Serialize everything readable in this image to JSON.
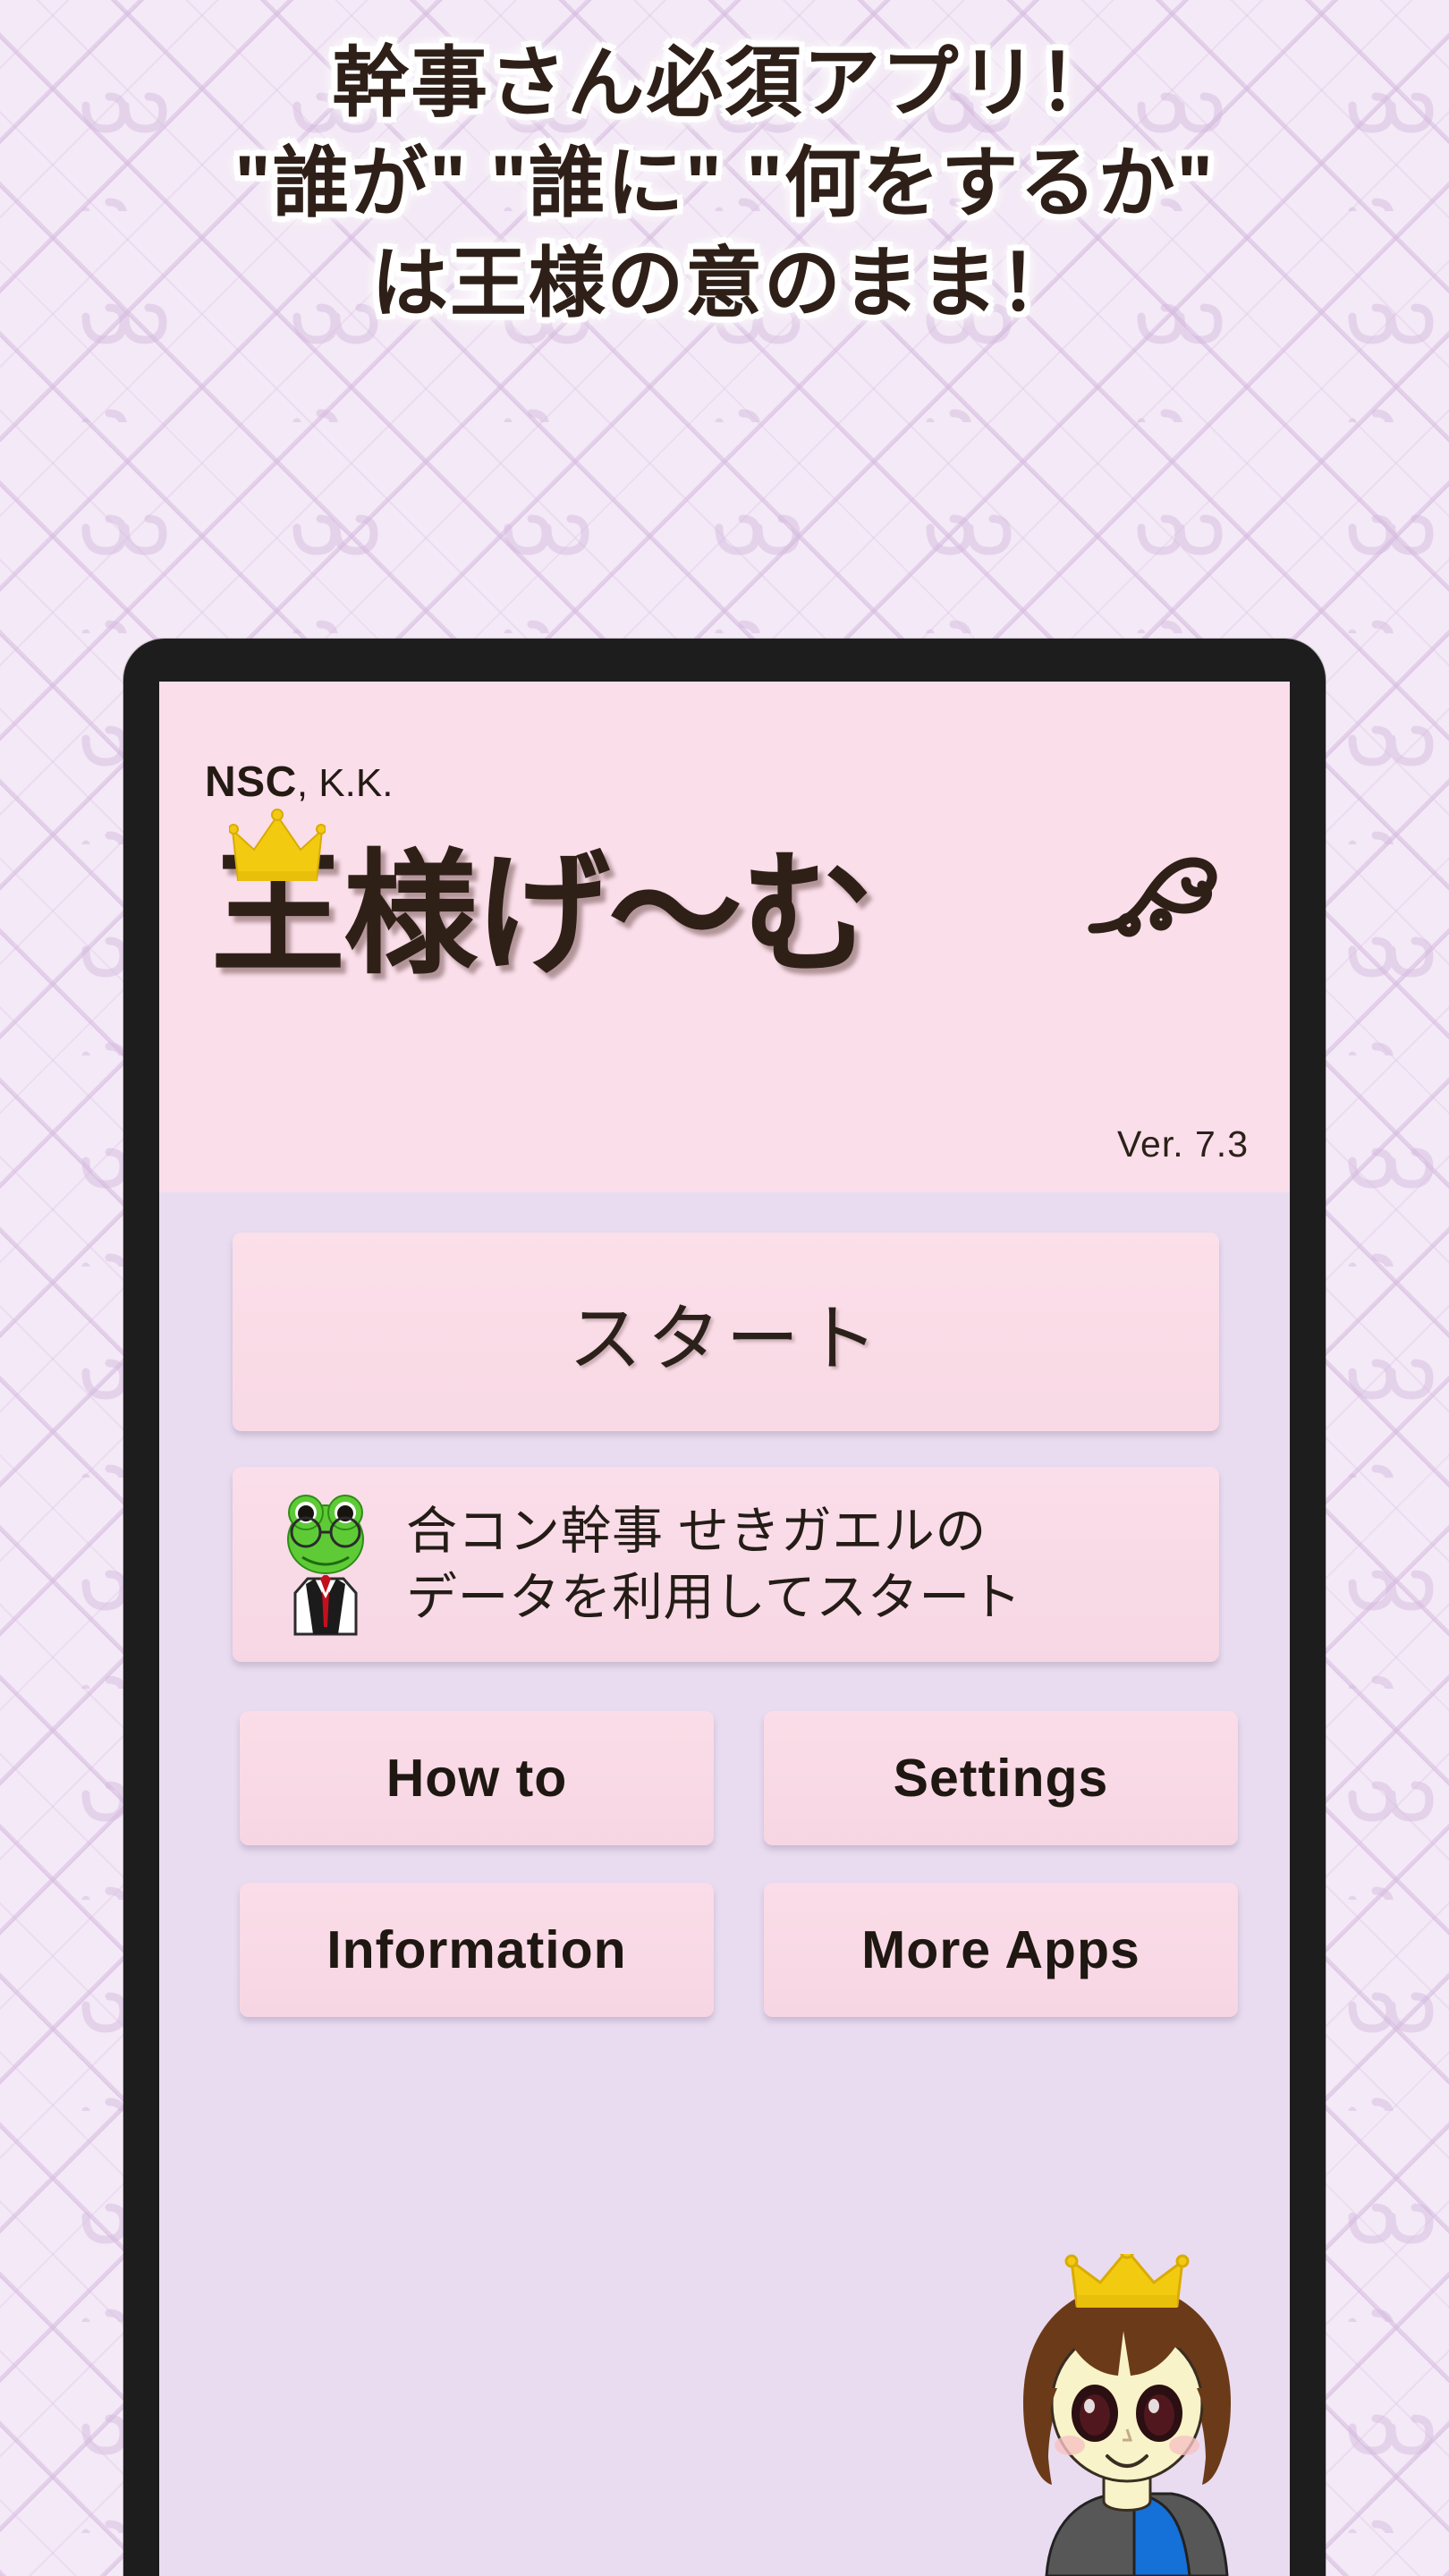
{
  "headline": {
    "line1": "幹事さん必須アプリ！",
    "line2": "\"誰が\" \"誰に\" \"何をするか\"",
    "line3": "は王様の意のまま！"
  },
  "colors": {
    "page_background": "#f4e9f6",
    "lattice": "#d6bce0",
    "phone_bezel": "#1d1d1d",
    "app_header_pink": "#fadeea",
    "app_body_lavender": "#e9dcf0",
    "button_pink": "#fadde8",
    "logo_brown": "#2f2017",
    "crown_gold": "#f2cb11",
    "frog_green": "#5ecb36",
    "mascot_hair": "#6b3a18",
    "mascot_shirt_blue": "#1570d8"
  },
  "app": {
    "brand_bold": "NSC",
    "brand_light": ", K.K.",
    "logo_title": "王様げ〜む",
    "version": "Ver. 7.3",
    "icons": {
      "logo_crown": "crown-icon",
      "logo_flourish": "flourish-ornament-icon",
      "frog": "frog-mascot-icon",
      "mascot": "king-girl-mascot-icon"
    }
  },
  "buttons": {
    "start": "スタート",
    "resume_line1": "合コン幹事 せきガエルの",
    "resume_line2": "データを利用してスタート",
    "how_to": "How to",
    "settings": "Settings",
    "information": "Information",
    "more_apps": "More Apps"
  }
}
